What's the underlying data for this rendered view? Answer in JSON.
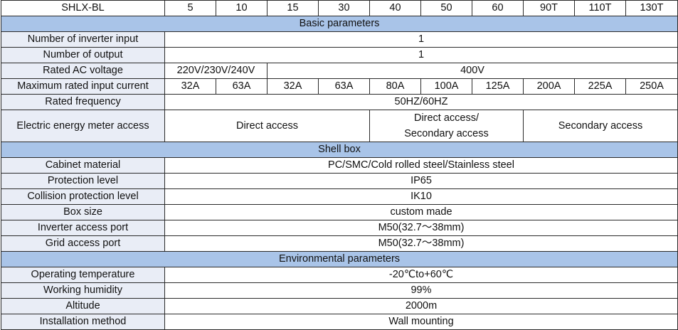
{
  "model": {
    "label": "SHLX-BL",
    "columns": [
      "5",
      "10",
      "15",
      "30",
      "40",
      "50",
      "60",
      "90T",
      "110T",
      "130T"
    ]
  },
  "sections": {
    "basic": "Basic parameters",
    "shell": "Shell box",
    "env": "Environmental parameters"
  },
  "basic": {
    "inverter_input": {
      "label": "Number of inverter input",
      "value": "1"
    },
    "output": {
      "label": "Number of output",
      "value": "1"
    },
    "rated_ac_voltage": {
      "label": "Rated AC voltage",
      "value_a": "220V/230V/240V",
      "value_b": "400V"
    },
    "max_input_current": {
      "label": "Maximum rated input current",
      "values": [
        "32A",
        "63A",
        "32A",
        "63A",
        "80A",
        "100A",
        "125A",
        "200A",
        "225A",
        "250A"
      ]
    },
    "rated_frequency": {
      "label": "Rated frequency",
      "value": "50HZ/60HZ"
    },
    "meter_access": {
      "label": "Electric energy meter access",
      "value_a": "Direct access",
      "value_b_line1": "Direct access/",
      "value_b_line2": "Secondary access",
      "value_c": "Secondary access"
    }
  },
  "shell": {
    "cabinet_material": {
      "label": "Cabinet material",
      "value": "PC/SMC/Cold rolled steel/Stainless steel"
    },
    "protection_level": {
      "label": "Protection level",
      "value": "IP65"
    },
    "collision_level": {
      "label": "Collision protection level",
      "value": "IK10"
    },
    "box_size": {
      "label": "Box size",
      "value": "custom made"
    },
    "inverter_port": {
      "label": "Inverter access port",
      "value": "M50(32.7～38mm)"
    },
    "grid_port": {
      "label": "Grid access port",
      "value": "M50(32.7～38mm)"
    }
  },
  "env": {
    "operating_temp": {
      "label": "Operating temperature",
      "value": "-20℃to+60℃"
    },
    "humidity": {
      "label": "Working humidity",
      "value": "99%"
    },
    "altitude": {
      "label": "Altitude",
      "value": "2000m"
    },
    "installation": {
      "label": "Installation method",
      "value": "Wall mounting"
    }
  },
  "colors": {
    "section_header": "#a9c4e8",
    "label_cell": "#e9edf6",
    "border": "#2a2a2a"
  }
}
